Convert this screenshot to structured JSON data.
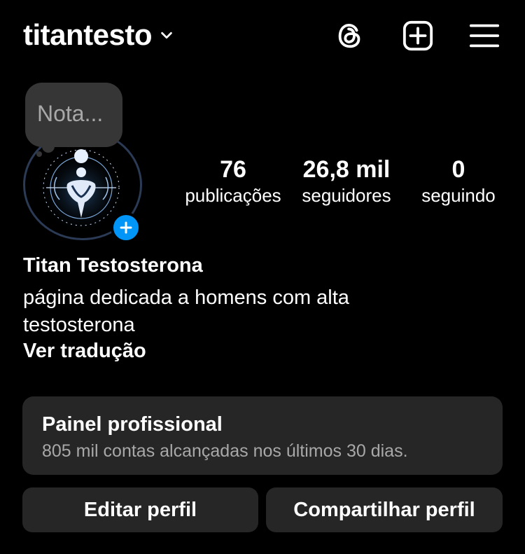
{
  "header": {
    "username": "titantesto",
    "icons": [
      "chevron-down-icon",
      "threads-icon",
      "create-post-icon",
      "menu-icon"
    ]
  },
  "note": {
    "placeholder": "Nota..."
  },
  "stats": [
    {
      "value": "76",
      "label": "publicações"
    },
    {
      "value": "26,8 mil",
      "label": "seguidores"
    },
    {
      "value": "0",
      "label": "seguindo"
    }
  ],
  "bio": {
    "name": "Titan Testosterona",
    "text": "página dedicada a homens com alta testosterona",
    "translate": "Ver tradução"
  },
  "dashboard": {
    "title": "Painel profissional",
    "subtitle": "805 mil contas alcançadas nos últimos 30 dias."
  },
  "buttons": {
    "edit": "Editar perfil",
    "share": "Compartilhar perfil"
  },
  "colors": {
    "background": "#000000",
    "card": "#262626",
    "accent": "#0095f6",
    "muted": "#a8a8a8"
  }
}
